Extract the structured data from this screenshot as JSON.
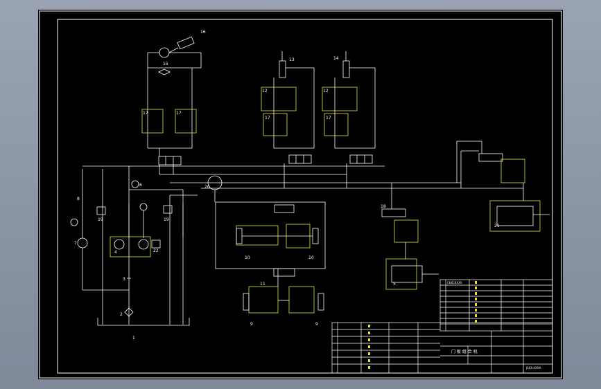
{
  "drawing": {
    "frame_color": "#ffffff",
    "highlight_color": "#e8e040",
    "background": "#000000"
  },
  "labels": {
    "n1": "1",
    "n2": "2",
    "n3": "3",
    "n4": "4",
    "n5": "5",
    "n6": "6",
    "n7": "7",
    "n8": "8",
    "n9a": "9",
    "n9b": "9",
    "n10a": "10",
    "n10b": "10",
    "n11": "11",
    "n12a": "12",
    "n12b": "12",
    "n13": "13",
    "n14": "14",
    "n15": "15",
    "n16": "16",
    "n17a": "17",
    "n17b": "17",
    "n17c": "17",
    "n17d": "17",
    "n18": "18",
    "n19a": "19",
    "n19b": "19",
    "n20": "20",
    "n21": "21",
    "n22": "22"
  },
  "title_block": {
    "code_text": "CKXCXXXX",
    "title_right": "门 板 组 合 机",
    "drawing_no": "JSXX-XXXX"
  }
}
